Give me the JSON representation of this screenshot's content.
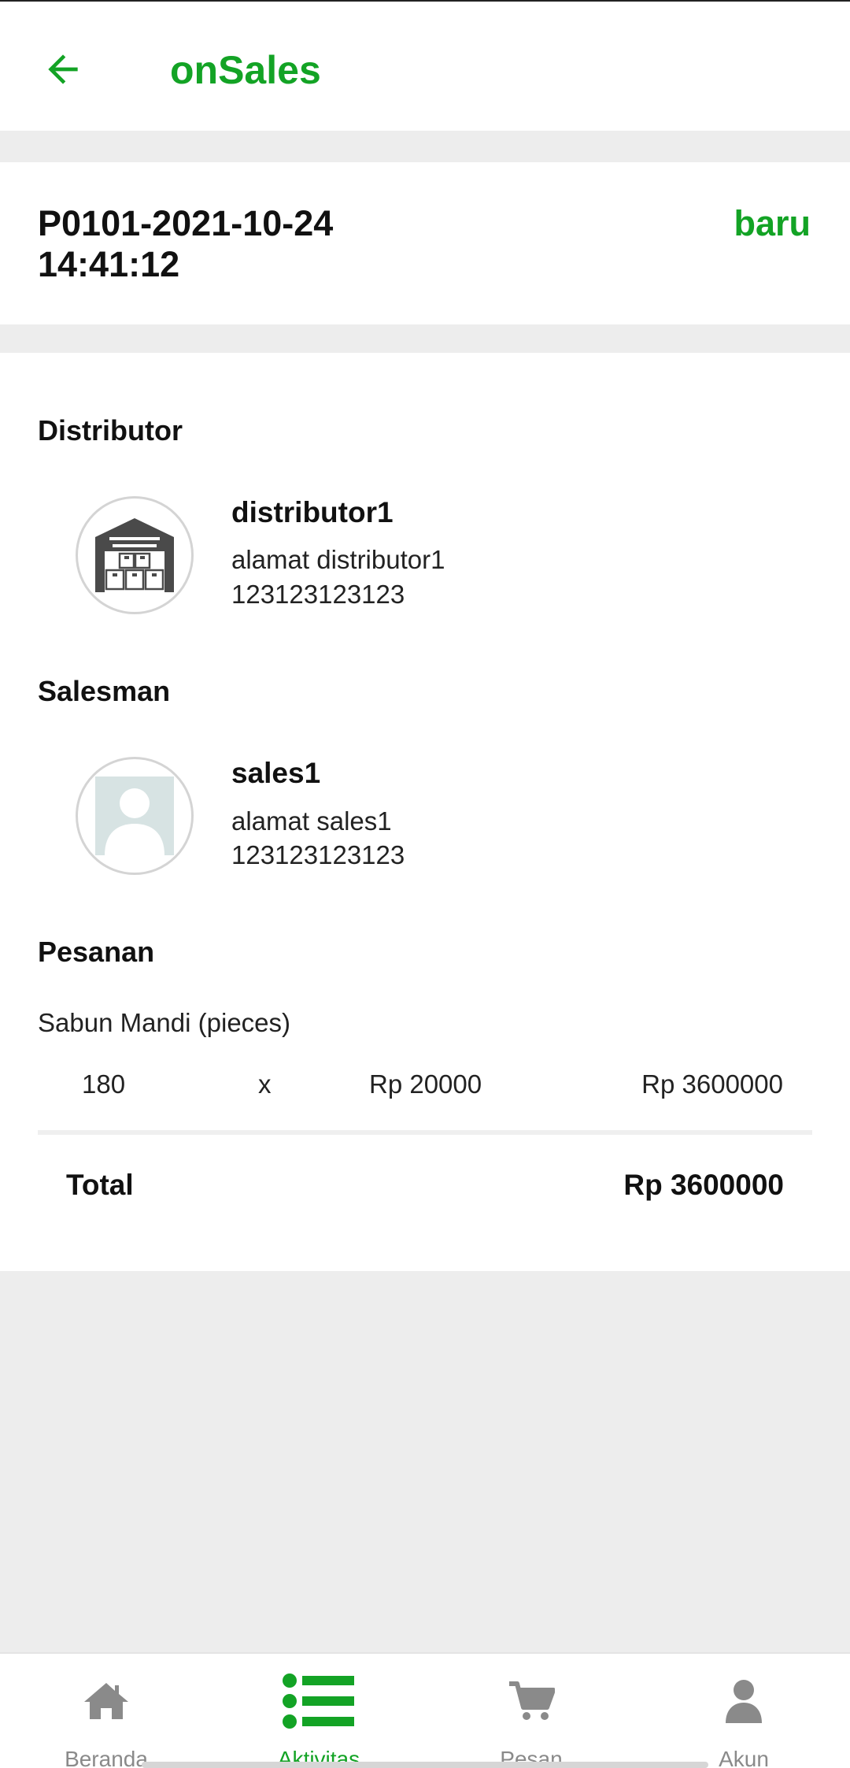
{
  "app": {
    "title": "onSales"
  },
  "order": {
    "id": "P0101-2021-10-24 14:41:12",
    "status": "baru"
  },
  "distributor": {
    "section_title": "Distributor",
    "name": "distributor1",
    "address": "alamat distributor1",
    "phone": "123123123123",
    "icon": "warehouse-icon"
  },
  "salesman": {
    "section_title": "Salesman",
    "name": "sales1",
    "address": "alamat sales1",
    "phone": "123123123123",
    "icon": "person-placeholder-icon"
  },
  "orders": {
    "section_title": "Pesanan",
    "items": [
      {
        "name": "Sabun Mandi (pieces)",
        "qty": "180",
        "times": "x",
        "price": "Rp 20000",
        "subtotal": "Rp 3600000"
      }
    ],
    "total_label": "Total",
    "total_value": "Rp 3600000"
  },
  "nav": {
    "items": [
      {
        "label": "Beranda",
        "icon": "home-icon",
        "active": false
      },
      {
        "label": "Aktivitas",
        "icon": "list-icon",
        "active": true
      },
      {
        "label": "Pesan",
        "icon": "cart-icon",
        "active": false
      },
      {
        "label": "Akun",
        "icon": "user-icon",
        "active": false
      }
    ]
  },
  "colors": {
    "accent": "#13a325",
    "background": "#ededed",
    "card": "#ffffff",
    "nav_inactive": "#8a8a8a"
  }
}
